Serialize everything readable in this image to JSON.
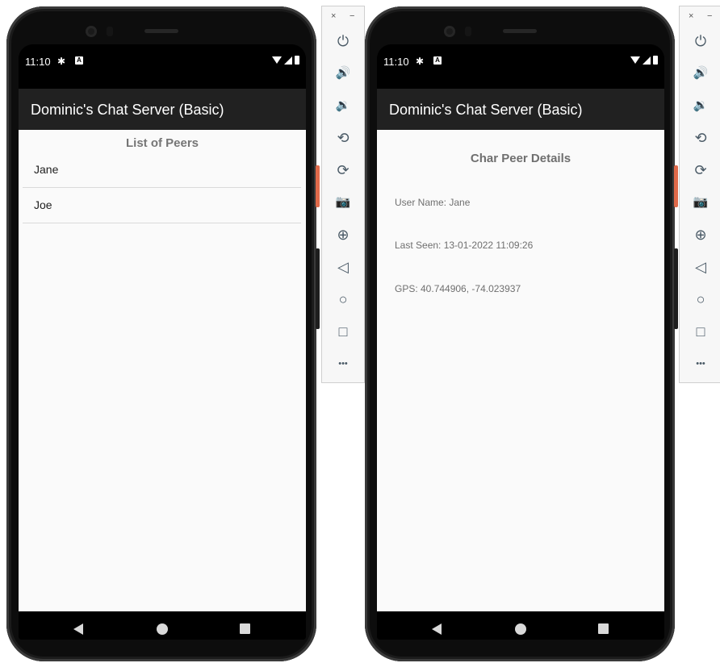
{
  "colors": {
    "appbar": "#212121",
    "content_bg": "#fafafa",
    "frame": "#0d0d0d",
    "accent_button": "#e06a4a"
  },
  "status_bar": {
    "time": "11:10",
    "icons": [
      "settings-icon",
      "a-badge-icon",
      "wifi-icon",
      "signal-icon",
      "battery-icon"
    ]
  },
  "app": {
    "title": "Dominic's Chat Server (Basic)"
  },
  "left_screen": {
    "header": "List of Peers",
    "peers": [
      {
        "name": "Jane"
      },
      {
        "name": "Joe"
      }
    ]
  },
  "right_screen": {
    "header": "Char Peer Details",
    "user_name": "User Name: Jane",
    "last_seen": "Last Seen: 13-01-2022 11:09:26",
    "gps": "GPS: 40.744906, -74.023937"
  },
  "emulator_toolbar": {
    "close": "×",
    "minimize": "−",
    "tools": [
      {
        "name": "power-icon",
        "glyph": "⏻"
      },
      {
        "name": "volume-up-icon",
        "glyph": "🔊"
      },
      {
        "name": "volume-down-icon",
        "glyph": "🔉"
      },
      {
        "name": "rotate-left-icon",
        "glyph": "⟲"
      },
      {
        "name": "rotate-right-icon",
        "glyph": "⟳"
      },
      {
        "name": "camera-icon",
        "glyph": "📷"
      },
      {
        "name": "zoom-icon",
        "glyph": "⊕"
      },
      {
        "name": "back-icon",
        "glyph": "◁"
      },
      {
        "name": "home-icon",
        "glyph": "○"
      },
      {
        "name": "overview-icon",
        "glyph": "□"
      },
      {
        "name": "more-icon",
        "glyph": "•••"
      }
    ]
  },
  "navigation_bar": {
    "icons": [
      "nav-back-icon",
      "nav-home-icon",
      "nav-recents-icon"
    ]
  }
}
